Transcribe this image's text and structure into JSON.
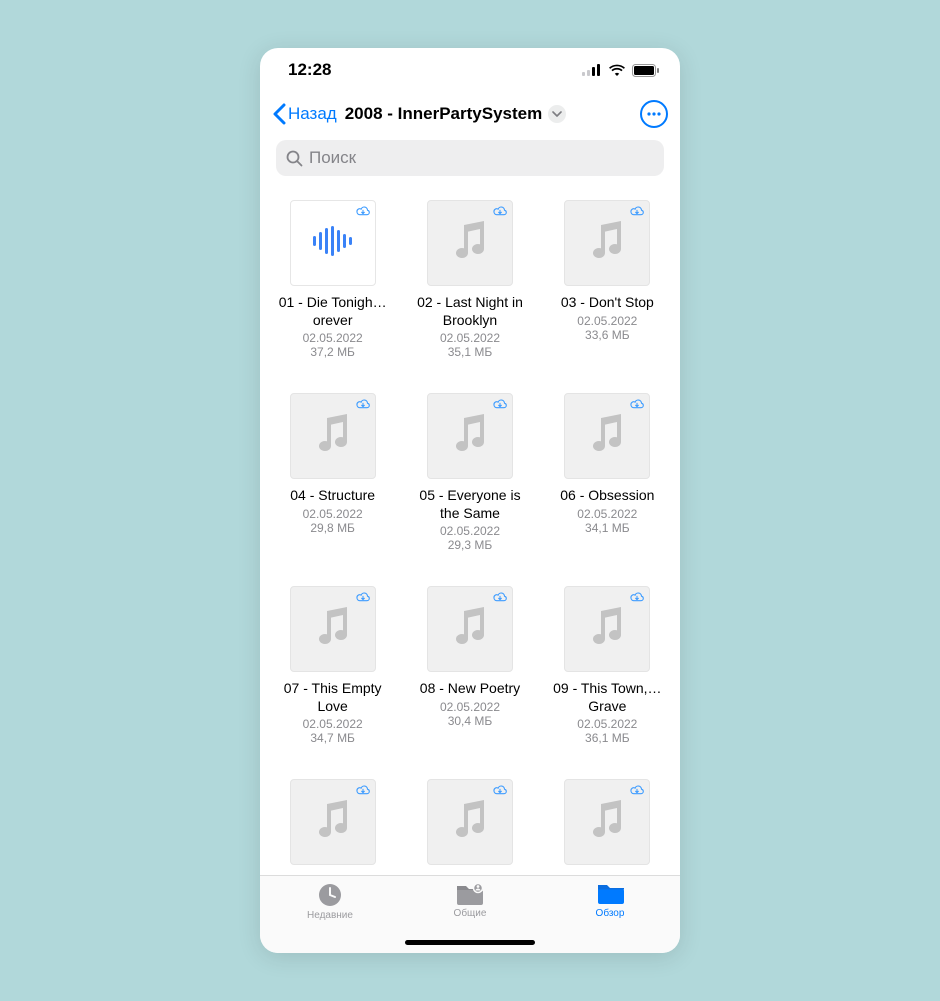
{
  "statusbar": {
    "time": "12:28"
  },
  "nav": {
    "back_label": "Назад",
    "title": "2008 - InnerPartySystem"
  },
  "search": {
    "placeholder": "Поиск"
  },
  "files": [
    {
      "title": "01 - Die Tonigh…orever",
      "date": "02.05.2022",
      "size": "37,2 МБ",
      "wave": true
    },
    {
      "title": "02 - Last Night in Brooklyn",
      "date": "02.05.2022",
      "size": "35,1 МБ"
    },
    {
      "title": "03 - Don't Stop",
      "date": "02.05.2022",
      "size": "33,6 МБ"
    },
    {
      "title": "04 - Structure",
      "date": "02.05.2022",
      "size": "29,8 МБ"
    },
    {
      "title": "05 - Everyone is the Same",
      "date": "02.05.2022",
      "size": "29,3 МБ"
    },
    {
      "title": "06 - Obsession",
      "date": "02.05.2022",
      "size": "34,1 МБ"
    },
    {
      "title": "07 - This Empty Love",
      "date": "02.05.2022",
      "size": "34,7 МБ"
    },
    {
      "title": "08 - New Poetry",
      "date": "02.05.2022",
      "size": "30,4 МБ"
    },
    {
      "title": "09 - This Town,…Grave",
      "date": "02.05.2022",
      "size": "36,1 МБ"
    },
    {
      "title": "",
      "date": "",
      "size": ""
    },
    {
      "title": "",
      "date": "",
      "size": ""
    },
    {
      "title": "",
      "date": "",
      "size": ""
    }
  ],
  "tabs": {
    "recent": "Недавние",
    "shared": "Общие",
    "browse": "Обзор"
  }
}
